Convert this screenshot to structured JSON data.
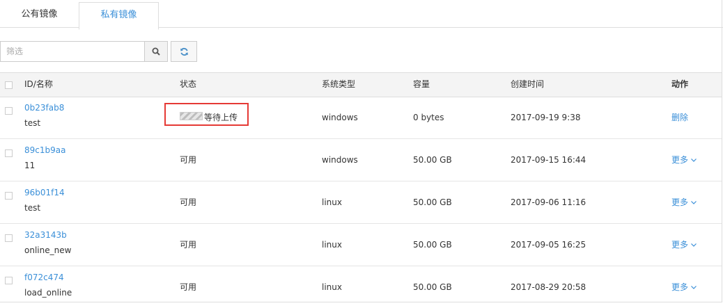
{
  "tabs": [
    {
      "label": "公有镜像",
      "active": false
    },
    {
      "label": "私有镜像",
      "active": true
    }
  ],
  "toolbar": {
    "filter_placeholder": "筛选",
    "search_icon": "search-icon",
    "refresh_icon": "refresh-icon"
  },
  "table": {
    "headers": {
      "id_name": "ID/名称",
      "status": "状态",
      "os_type": "系统类型",
      "capacity": "容量",
      "created": "创建时间",
      "action": "动作"
    },
    "rows": [
      {
        "id": "0b23fab8",
        "name": "test",
        "status": "等待上传",
        "status_progress": 0,
        "os": "windows",
        "capacity": "0 bytes",
        "created": "2017-09-19 9:38",
        "action": "删除"
      },
      {
        "id": "89c1b9aa",
        "name": "11",
        "status": "可用",
        "os": "windows",
        "capacity": "50.00 GB",
        "created": "2017-09-15 16:44",
        "action": "更多"
      },
      {
        "id": "96b01f14",
        "name": "test",
        "status": "可用",
        "os": "linux",
        "capacity": "50.00 GB",
        "created": "2017-09-06 11:16",
        "action": "更多"
      },
      {
        "id": "32a3143b",
        "name": "online_new",
        "status": "可用",
        "os": "linux",
        "capacity": "50.00 GB",
        "created": "2017-09-05 16:25",
        "action": "更多"
      },
      {
        "id": "f072c474",
        "name": "load_online",
        "status": "可用",
        "os": "linux",
        "capacity": "50.00 GB",
        "created": "2017-08-29 20:58",
        "action": "更多"
      }
    ]
  },
  "colors": {
    "link": "#3a8fd8",
    "highlight_border": "#e53935",
    "header_bg": "#f4f4f4"
  }
}
